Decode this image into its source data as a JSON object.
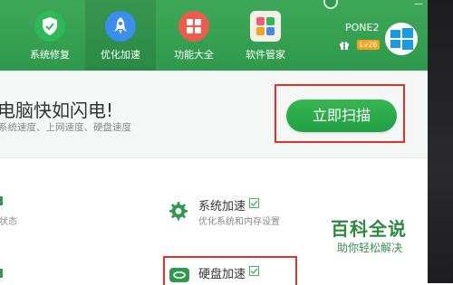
{
  "colors": {
    "header_green": "#33a050",
    "button_green": "#2aa748",
    "highlight_red": "#e0312a",
    "level_badge": "#f2a31b"
  },
  "nav": {
    "items": [
      {
        "label": "系统修复",
        "icon": "shield-icon",
        "active": false
      },
      {
        "label": "优化加速",
        "icon": "rocket-icon",
        "active": true
      },
      {
        "label": "功能大全",
        "icon": "grid-icon",
        "active": false
      },
      {
        "label": "软件管家",
        "icon": "apps-icon",
        "active": false
      }
    ]
  },
  "account": {
    "name": "PONE2",
    "level": "Lv26"
  },
  "banner": {
    "headline": "电脑快如闪电!",
    "subline": "系统速度、上网速度、硬盘速度",
    "scan_button": "立即扫描"
  },
  "features": {
    "left_partial_1": "状态",
    "system_speedup": {
      "title": "系统加速",
      "desc": "优化系统和内存设置",
      "checked": true
    },
    "disk_speedup": {
      "title": "硬盘加速",
      "checked": true
    }
  },
  "watermark": {
    "title": "百科全说",
    "subtitle": "助你轻松解决"
  }
}
